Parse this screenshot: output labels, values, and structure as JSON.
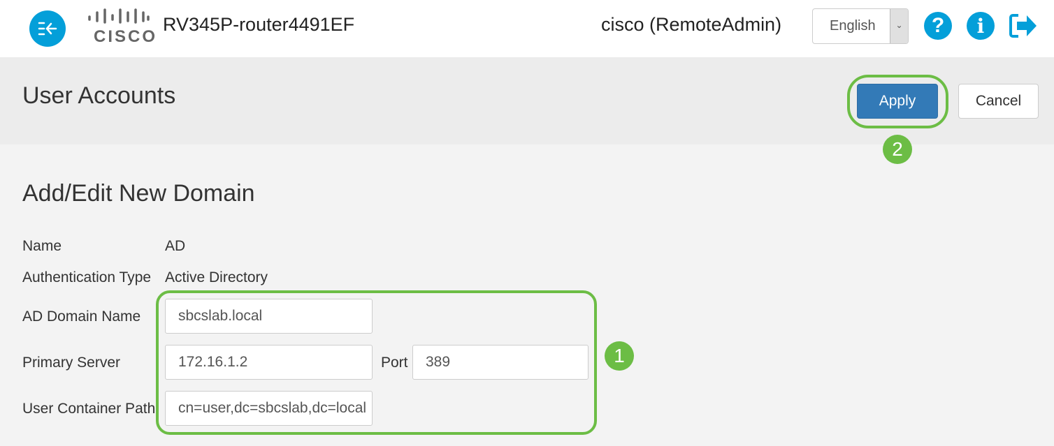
{
  "header": {
    "device_name": "RV345P-router4491EF",
    "user": "cisco (RemoteAdmin)",
    "language": "English",
    "logo_text": "cisco"
  },
  "page": {
    "title": "User Accounts",
    "apply": "Apply",
    "cancel": "Cancel"
  },
  "section": {
    "title": "Add/Edit New Domain"
  },
  "form": {
    "name_label": "Name",
    "name_value": "AD",
    "auth_label": "Authentication Type",
    "auth_value": "Active Directory",
    "domain_label": "AD Domain Name",
    "domain_value": "sbcslab.local",
    "server_label": "Primary Server",
    "server_value": "172.16.1.2",
    "port_label": "Port",
    "port_value": "389",
    "path_label": "User Container Path",
    "path_value": "cn=user,dc=sbcslab,dc=local"
  },
  "annotations": {
    "step1": "1",
    "step2": "2",
    "highlight_color": "#6cbd45"
  },
  "colors": {
    "accent": "#049fd9",
    "apply": "#337ab7"
  }
}
